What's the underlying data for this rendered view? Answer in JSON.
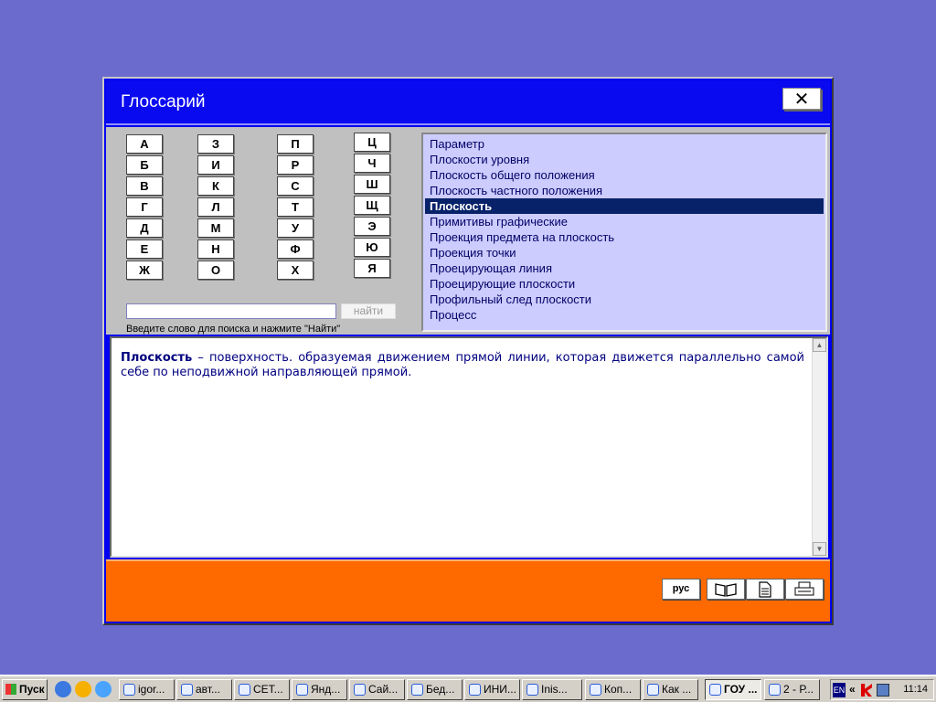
{
  "window": {
    "title": "Глоссарий",
    "close_label": "✕"
  },
  "letters": [
    [
      "А",
      "Б",
      "В",
      "Г",
      "Д",
      "Е",
      "Ж"
    ],
    [
      "З",
      "И",
      "К",
      "Л",
      "М",
      "Н",
      "О"
    ],
    [
      "П",
      "Р",
      "С",
      "Т",
      "У",
      "Ф",
      "Х"
    ],
    [
      "Ц",
      "Ч",
      "Ш",
      "Щ",
      "Э",
      "Ю",
      "Я"
    ]
  ],
  "search": {
    "value": "",
    "button_label": "найти",
    "hint": "Введите слово для поиска и нажмите \"Найти\""
  },
  "terms": [
    "Параметр",
    "Плоскости уровня",
    "Плоскость общего положения",
    "Плоскость частного  положения",
    "Плоскость",
    "Примитивы графические",
    "Проекция предмета на плоскость",
    "Проекция точки",
    "Проецирующая линия",
    "Проецирующие плоскости",
    "Профильный след плоскости",
    "Процесс"
  ],
  "selected_term_index": 4,
  "definition": {
    "term": "Плоскость",
    "text": " – поверхность. образуемая движением прямой линии, которая движется параллельно самой себе по неподвижной направляющей прямой."
  },
  "footer": {
    "lang_label": "рус",
    "icons": [
      "book-icon",
      "document-icon",
      "print-icon"
    ]
  },
  "taskbar": {
    "start_label": "Пуск",
    "tasks": [
      "igor...",
      "авт...",
      "СЕТ...",
      "Янд...",
      "Сай...",
      "Бед...",
      "ИНИ...",
      "Inis...",
      "Коп...",
      "Как ...",
      "ГОУ ...",
      "2 - Р..."
    ],
    "active_task_index": 10,
    "lang": "EN",
    "clock": "11:14"
  }
}
